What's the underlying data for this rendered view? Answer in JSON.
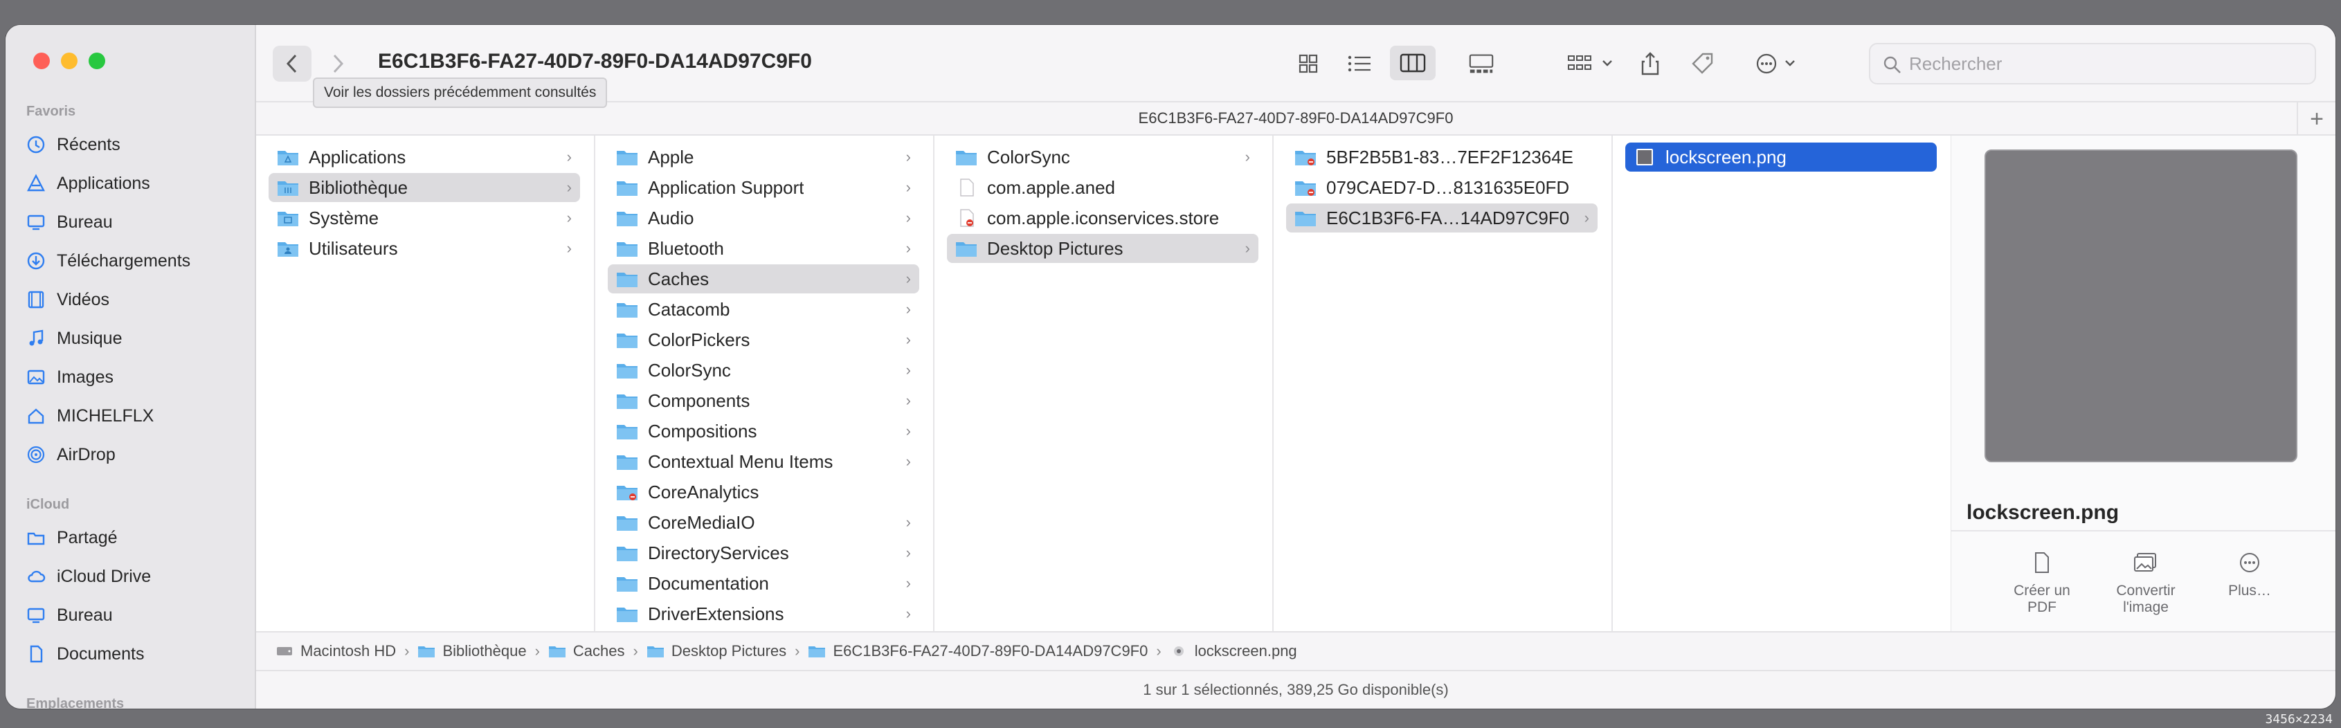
{
  "window": {
    "title": "E6C1B3F6-FA27-40D7-89F0-DA14AD97C9F0",
    "path_title": "E6C1B3F6-FA27-40D7-89F0-DA14AD97C9F0",
    "tooltip": "Voir les dossiers précédemment consultés",
    "search_placeholder": "Rechercher",
    "add_tab": "+"
  },
  "sidebar": {
    "favorites_label": "Favoris",
    "favorites": [
      {
        "label": "Récents",
        "icon": "clock-icon"
      },
      {
        "label": "Applications",
        "icon": "applications-icon"
      },
      {
        "label": "Bureau",
        "icon": "desktop-icon"
      },
      {
        "label": "Téléchargements",
        "icon": "download-icon"
      },
      {
        "label": "Vidéos",
        "icon": "film-icon"
      },
      {
        "label": "Musique",
        "icon": "music-icon"
      },
      {
        "label": "Images",
        "icon": "photo-icon"
      },
      {
        "label": "MICHELFLX",
        "icon": "home-icon"
      },
      {
        "label": "AirDrop",
        "icon": "airdrop-icon"
      }
    ],
    "icloud_label": "iCloud",
    "icloud": [
      {
        "label": "Partagé",
        "icon": "shared-folder-icon"
      },
      {
        "label": "iCloud Drive",
        "icon": "cloud-icon"
      },
      {
        "label": "Bureau",
        "icon": "desktop-icon"
      },
      {
        "label": "Documents",
        "icon": "document-icon"
      }
    ],
    "locations_label": "Emplacements"
  },
  "columns": {
    "col1": [
      "Applications",
      "Bibliothèque",
      "Système",
      "Utilisateurs"
    ],
    "col2": [
      "Apple",
      "Application Support",
      "Audio",
      "Bluetooth",
      "Caches",
      "Catacomb",
      "ColorPickers",
      "ColorSync",
      "Components",
      "Compositions",
      "Contextual Menu Items",
      "CoreAnalytics",
      "CoreMediaIO",
      "DirectoryServices",
      "Documentation",
      "DriverExtensions"
    ],
    "col3": [
      "ColorSync",
      "com.apple.aned",
      "com.apple.iconservices.store",
      "Desktop Pictures"
    ],
    "col4": [
      "5BF2B5B1-83…7EF2F12364E",
      "079CAED7-D…8131635E0FD",
      "E6C1B3F6-FA…14AD97C9F0"
    ],
    "col5": [
      "lockscreen.png"
    ]
  },
  "preview": {
    "filename": "lockscreen.png",
    "actions": [
      {
        "label1": "Créer un",
        "label2": "PDF"
      },
      {
        "label1": "Convertir",
        "label2": "l'image"
      },
      {
        "label1": "Plus…",
        "label2": ""
      }
    ]
  },
  "pathbar": {
    "crumbs": [
      "Macintosh HD",
      "Bibliothèque",
      "Caches",
      "Desktop Pictures",
      "E6C1B3F6-FA27-40D7-89F0-DA14AD97C9F0",
      "lockscreen.png"
    ]
  },
  "status": "1 sur 1 sélectionnés, 389,25 Go disponible(s)",
  "screen_size": "3456×2234",
  "colors": {
    "accent": "#2564d9",
    "folder": "#5aaeea"
  }
}
